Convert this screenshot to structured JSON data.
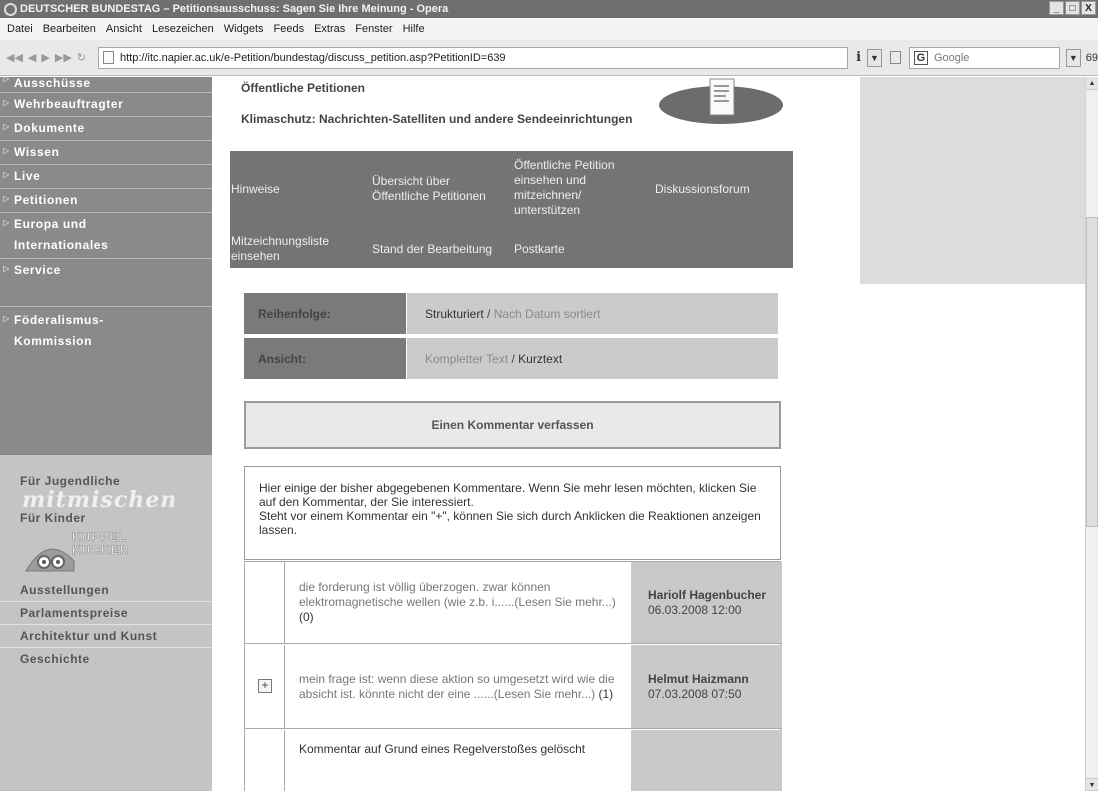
{
  "window": {
    "title": "DEUTSCHER BUNDESTAG – Petitionsausschuss: Sagen Sie Ihre Meinung - Opera",
    "controls": [
      "_",
      "□",
      "X"
    ]
  },
  "menu": {
    "items": [
      "Datei",
      "Bearbeiten",
      "Ansicht",
      "Lesezeichen",
      "Widgets",
      "Feeds",
      "Extras",
      "Fenster",
      "Hilfe"
    ]
  },
  "address": {
    "url": "http://itc.napier.ac.uk/e-Petition/bundestag/discuss_petition.asp?PetitionID=639",
    "info_label": "i",
    "search_engine": "Google",
    "zoom": "69"
  },
  "sidebar": {
    "nav": [
      {
        "label": "Ausschüsse"
      },
      {
        "label": "Wehrbeauftragter"
      },
      {
        "label": "Dokumente"
      },
      {
        "label": "Wissen"
      },
      {
        "label": "Live"
      },
      {
        "label": "Petitionen"
      },
      {
        "label": "Europa und",
        "label2": "Internationales"
      },
      {
        "label": "Service"
      },
      {
        "label": "Föderalismus-",
        "label2": "Kommission"
      }
    ],
    "youth_label": "Für Jugendliche",
    "youth_logo": "mitmischen",
    "kids_label": "Für Kinder",
    "kids_logo_line1": "KUPPEL",
    "kids_logo_line2": "KUCKER",
    "links": [
      "Ausstellungen",
      "Parlamentspreise",
      "Architektur und Kunst",
      "Geschichte"
    ]
  },
  "main": {
    "section_label": "Öffentliche Petitionen",
    "petition_title": "Klimaschutz: Nachrichten-Satelliten und andere Sendeeinrichtungen",
    "tabs": [
      "Hinweise",
      "Übersicht über Öffentliche Petitionen",
      "Öffentliche Petition einsehen und mitzeichnen/ unterstützen",
      "Diskussionsforum",
      "Mitzeichnungsliste einsehen",
      "Stand der Bearbeitung",
      "Postkarte"
    ],
    "order": {
      "label": "Reihenfolge:",
      "option_active": "Strukturiert",
      "separator": " / ",
      "option_link": "Nach Datum sortiert"
    },
    "view": {
      "label": "Ansicht:",
      "option_link": "Kompletter Text",
      "separator": " / ",
      "option_active": "Kurztext"
    },
    "comment_button": "Einen Kommentar verfassen",
    "intro": {
      "line1": "Hier einige der bisher abgegebenen Kommentare. Wenn Sie mehr lesen möchten, klicken Sie auf den Kommentar, der Sie interessiert.",
      "line2": "Steht vor einem Kommentar ein \"+\", können Sie sich durch Anklicken die Reaktionen anzeigen lassen."
    },
    "comments": [
      {
        "plus": "",
        "text": "die forderung ist völlig überzogen. zwar können elektromagnetische wellen (wie z.b. i......(Lesen Sie mehr...)",
        "count": "(0)",
        "author": "Hariolf Hagenbucher",
        "date": "06.03.2008 12:00"
      },
      {
        "plus": "+",
        "text": "mein frage ist: wenn diese aktion so umgesetzt wird wie die absicht ist. könnte nicht der eine ......(Lesen Sie mehr...)",
        "count": "(1)",
        "author": "Helmut Haizmann",
        "date": "07.03.2008 07:50"
      },
      {
        "plus": "",
        "text": "Kommentar auf Grund eines Regelverstoßes gelöscht",
        "count": "",
        "author": "",
        "date": ""
      }
    ]
  }
}
